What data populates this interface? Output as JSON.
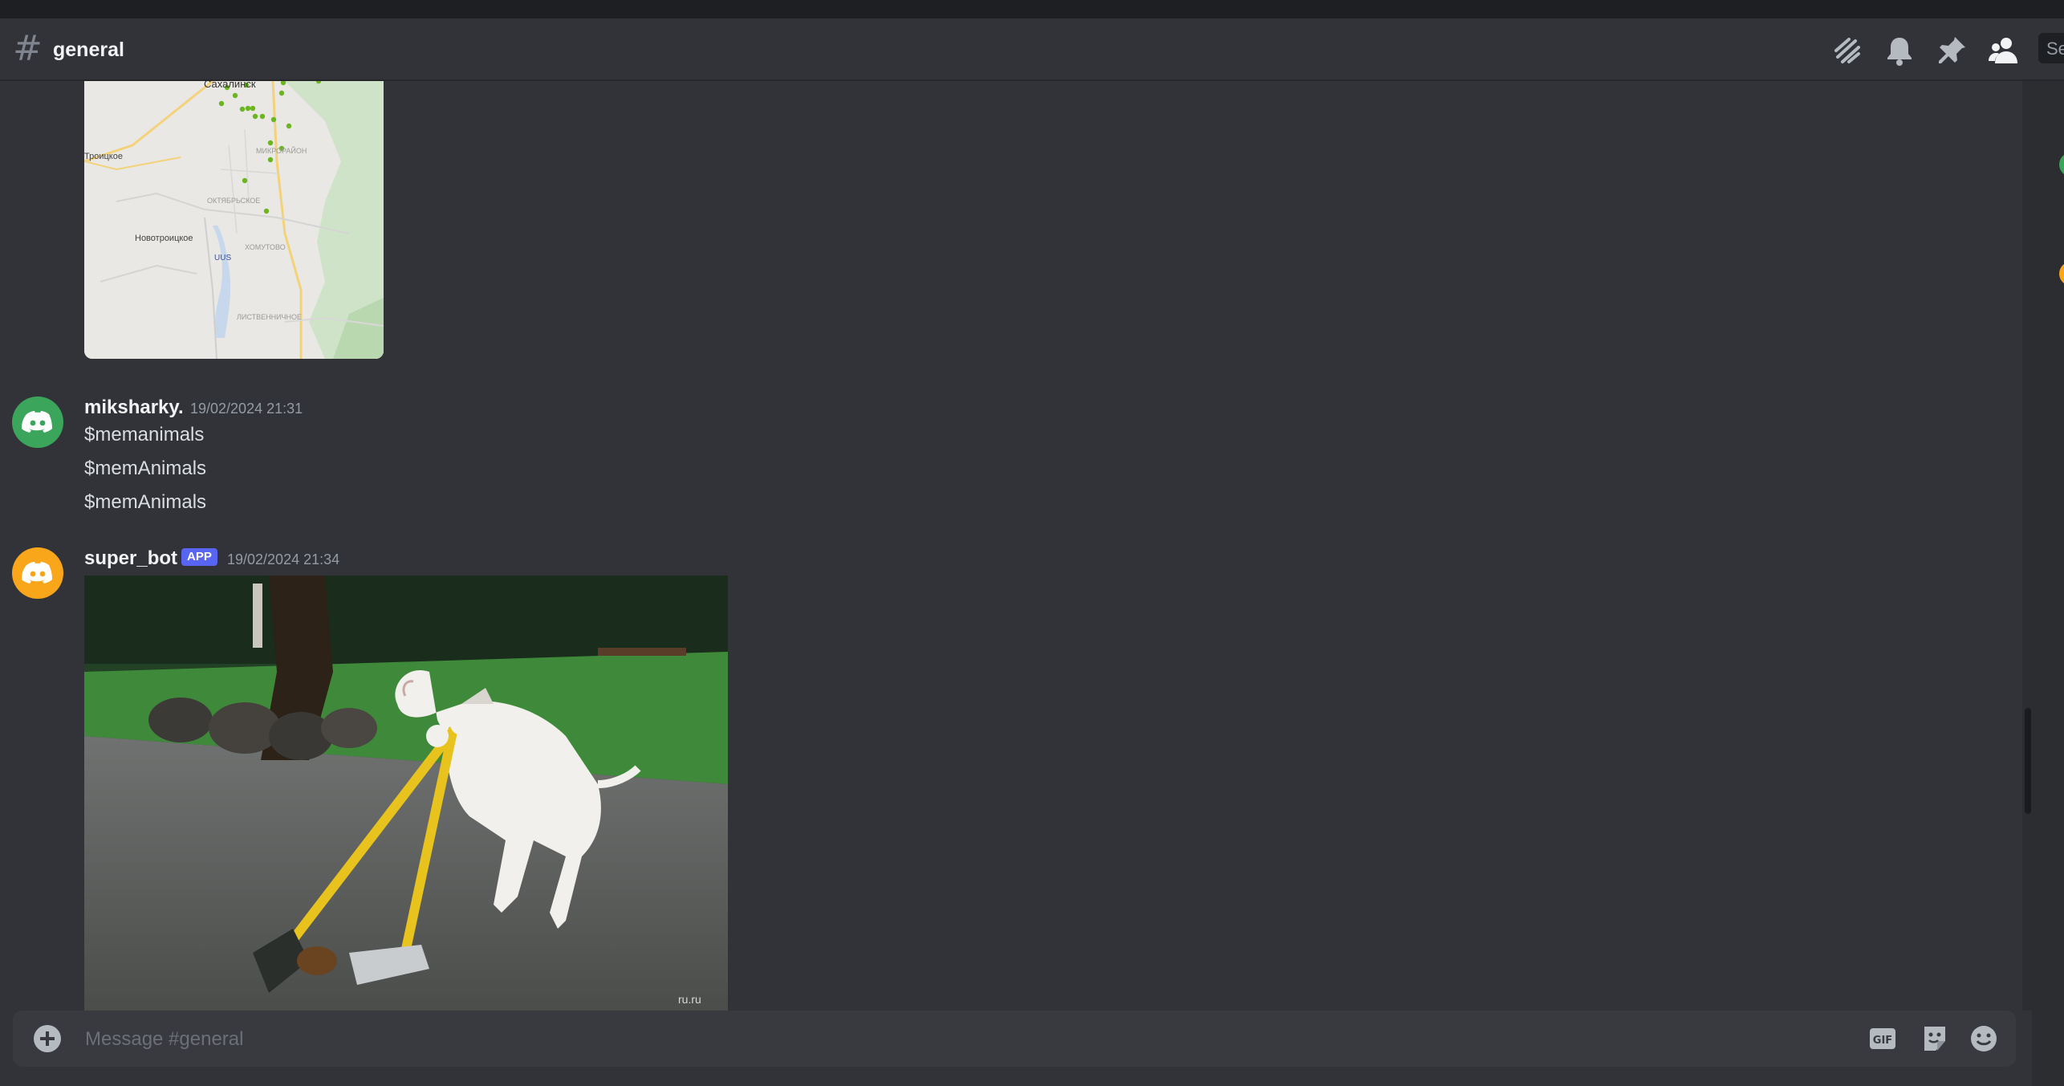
{
  "header": {
    "channel_name": "general",
    "search_placeholder": "Se",
    "icons": [
      "threads-icon",
      "bell-icon",
      "pin-icon",
      "members-icon"
    ]
  },
  "map_embed": {
    "labels": [
      "Сахалинск",
      "Троицкое",
      "МИКРОРАЙОН",
      "ОКТЯБРЬСКОЕ",
      "Новотроицкое",
      "ХОМУТОВО",
      "UUS",
      "ЛИСТВЕННИЧНОЕ"
    ]
  },
  "messages": [
    {
      "username": "miksharky.",
      "timestamp": "19/02/2024 21:31",
      "lines": [
        "$memanimals",
        "$memAnimals",
        "$memAnimals"
      ],
      "avatar_color": "#3ba55c"
    },
    {
      "username": "super_bot",
      "badge": "APP",
      "timestamp": "19/02/2024 21:34",
      "avatar_color": "#faa61a",
      "image_watermark": "ru.ru"
    }
  ],
  "composer": {
    "placeholder": "Message #general",
    "icons": [
      "plus-icon",
      "gif-icon",
      "sticker-icon",
      "emoji-icon"
    ]
  },
  "colors": {
    "background": "#313338",
    "blurple": "#5865f2",
    "green_avatar": "#3ba55c",
    "orange_avatar": "#faa61a"
  }
}
